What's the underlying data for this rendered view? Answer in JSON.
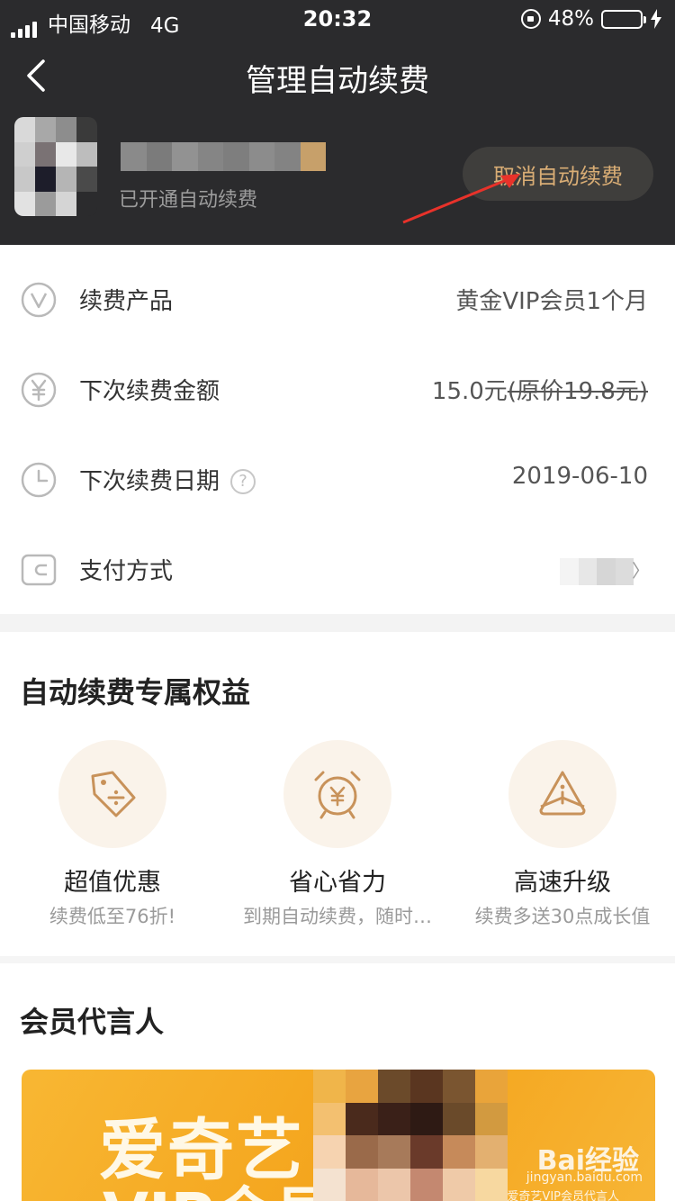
{
  "status_bar": {
    "carrier": "中国移动",
    "network": "4G",
    "time": "20:32",
    "battery_pct": "48%",
    "battery_level": 0.48,
    "battery_color": "#4cd964"
  },
  "nav": {
    "back_icon": "chevron-left-icon",
    "title": "管理自动续费"
  },
  "user": {
    "status": "已开通自动续费",
    "cancel_label": "取消自动续费",
    "accent_color": "#d9ad75"
  },
  "rows": [
    {
      "icon": "vip-v-icon",
      "label": "续费产品",
      "value": "黄金VIP会员1个月"
    },
    {
      "icon": "yuan-coin-icon",
      "label": "下次续费金额",
      "value": "15.0元",
      "value_strike": "(原价19.8元)"
    },
    {
      "icon": "clock-icon",
      "label": "下次续费日期",
      "help": "?",
      "value": "2019-06-10"
    },
    {
      "icon": "wallet-icon",
      "label": "支付方式",
      "chevron": "〉"
    }
  ],
  "benefits_section": {
    "title": "自动续费专属权益",
    "items": [
      {
        "icon": "discount-tag-icon",
        "title": "超值优惠",
        "subtitle": "续费低至76折!"
      },
      {
        "icon": "alarm-clock-icon",
        "title": "省心省力",
        "subtitle": "到期自动续费，随时…"
      },
      {
        "icon": "growth-warning-icon",
        "title": "高速升级",
        "subtitle": "续费多送30点成长值"
      }
    ]
  },
  "spokesperson_section": {
    "title": "会员代言人",
    "banner_line1": "爱奇艺",
    "banner_line2": "VIP会员",
    "watermark": "Bai经验",
    "watermark_url": "jingyan.baidu.com",
    "watermark_caption": "爱奇艺VIP会员代言人"
  },
  "colors": {
    "header_bg": "#2b2b2d",
    "icon_gold": "#c8925a",
    "banner_orange": "#f4a41c"
  }
}
